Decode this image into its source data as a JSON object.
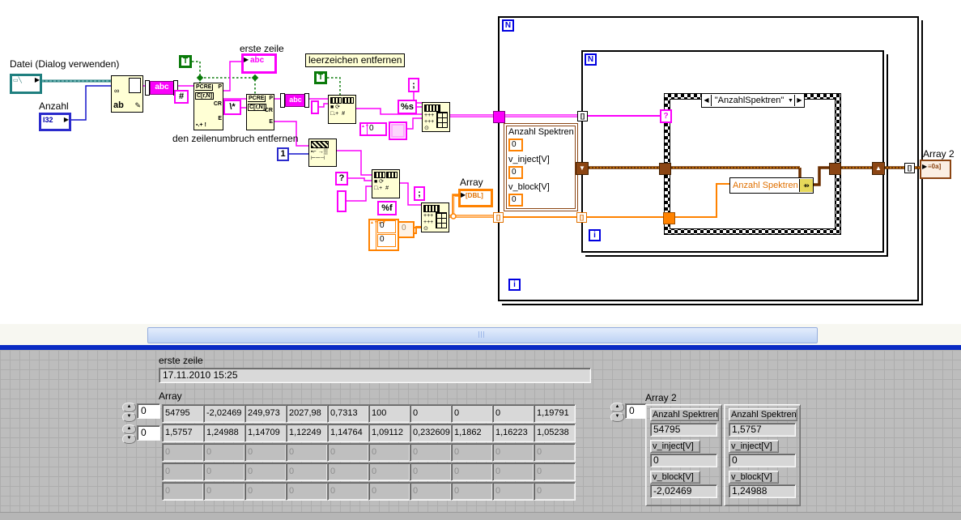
{
  "diagram": {
    "file_label": "Datei (Dialog verwenden)",
    "count_label": "Anzahl",
    "i32": "I32",
    "first_line_label": "erste zeile",
    "remove_spaces_label": "leerzeichen entfernen",
    "remove_linebreak_label": "den zeilenumbruch entfernen",
    "array_indicator_label": "Array",
    "array2_indicator_label": "Array 2",
    "abc": "abc",
    "true_const": "T",
    "hash_const": "#",
    "star_const": "\\*",
    "question_const": "?",
    "semicolon_const": ";",
    "format_s": "%s",
    "format_f": "%f",
    "one_const": "1",
    "zero_const": "0",
    "dbl": "[DBL]",
    "array2_glyph": "≡0a]",
    "pcre": {
      "t1": "PCRE",
      "t2": "C[r,N]",
      "p": "P",
      "cr": "CR",
      "e": "E"
    },
    "loop_n": "N",
    "loop_i": "i",
    "index_glyph": "[]",
    "case_selector": "\"AnzahlSpektren\"",
    "selector_left": "◀",
    "selector_right": "▶",
    "selector_drop": "▼",
    "bundle_element": "Anzahl Spektren",
    "cluster_constant": {
      "fields": [
        {
          "label": "Anzahl Spektren",
          "value": "0"
        },
        {
          "label": "v_inject[V]",
          "value": "0"
        },
        {
          "label": "v_block[V]",
          "value": "0"
        }
      ]
    },
    "colors": {
      "string": "#FB00FB",
      "dbl_orange": "#FF8200",
      "cluster_brown": "#8B4513",
      "bool_green": "#0A7A0A",
      "int_blue": "#1414CC",
      "path_teal": "#1F7A7A",
      "node_bg": "#FFFFD5"
    }
  },
  "panel": {
    "first_line": {
      "label": "erste zeile",
      "value": "17.11.2010 15:25"
    },
    "array": {
      "label": "Array",
      "index_values": [
        "0",
        "0"
      ],
      "rows": [
        {
          "dim": false,
          "values": [
            "54795",
            "-2,02469",
            "249,973",
            "2027,98",
            "0,7313",
            "100",
            "0",
            "0",
            "0",
            "1,19791"
          ]
        },
        {
          "dim": false,
          "values": [
            "1,5757",
            "1,24988",
            "1,14709",
            "1,12249",
            "1,14764",
            "1,09112",
            "0,232609",
            "1,1862",
            "1,16223",
            "1,05238"
          ]
        },
        {
          "dim": true,
          "values": [
            "0",
            "0",
            "0",
            "0",
            "0",
            "0",
            "0",
            "0",
            "0",
            "0"
          ]
        },
        {
          "dim": true,
          "values": [
            "0",
            "0",
            "0",
            "0",
            "0",
            "0",
            "0",
            "0",
            "0",
            "0"
          ]
        },
        {
          "dim": true,
          "values": [
            "0",
            "0",
            "0",
            "0",
            "0",
            "0",
            "0",
            "0",
            "0",
            "0"
          ]
        }
      ]
    },
    "array2": {
      "label": "Array 2",
      "index_value": "0",
      "clusters": [
        {
          "fields": [
            {
              "label": "Anzahl Spektren",
              "value": "54795"
            },
            {
              "label": "v_inject[V]",
              "value": "0"
            },
            {
              "label": "v_block[V]",
              "value": "-2,02469"
            }
          ]
        },
        {
          "fields": [
            {
              "label": "Anzahl Spektren",
              "value": "1,5757"
            },
            {
              "label": "v_inject[V]",
              "value": "0"
            },
            {
              "label": "v_block[V]",
              "value": "1,24988"
            }
          ]
        }
      ]
    }
  }
}
